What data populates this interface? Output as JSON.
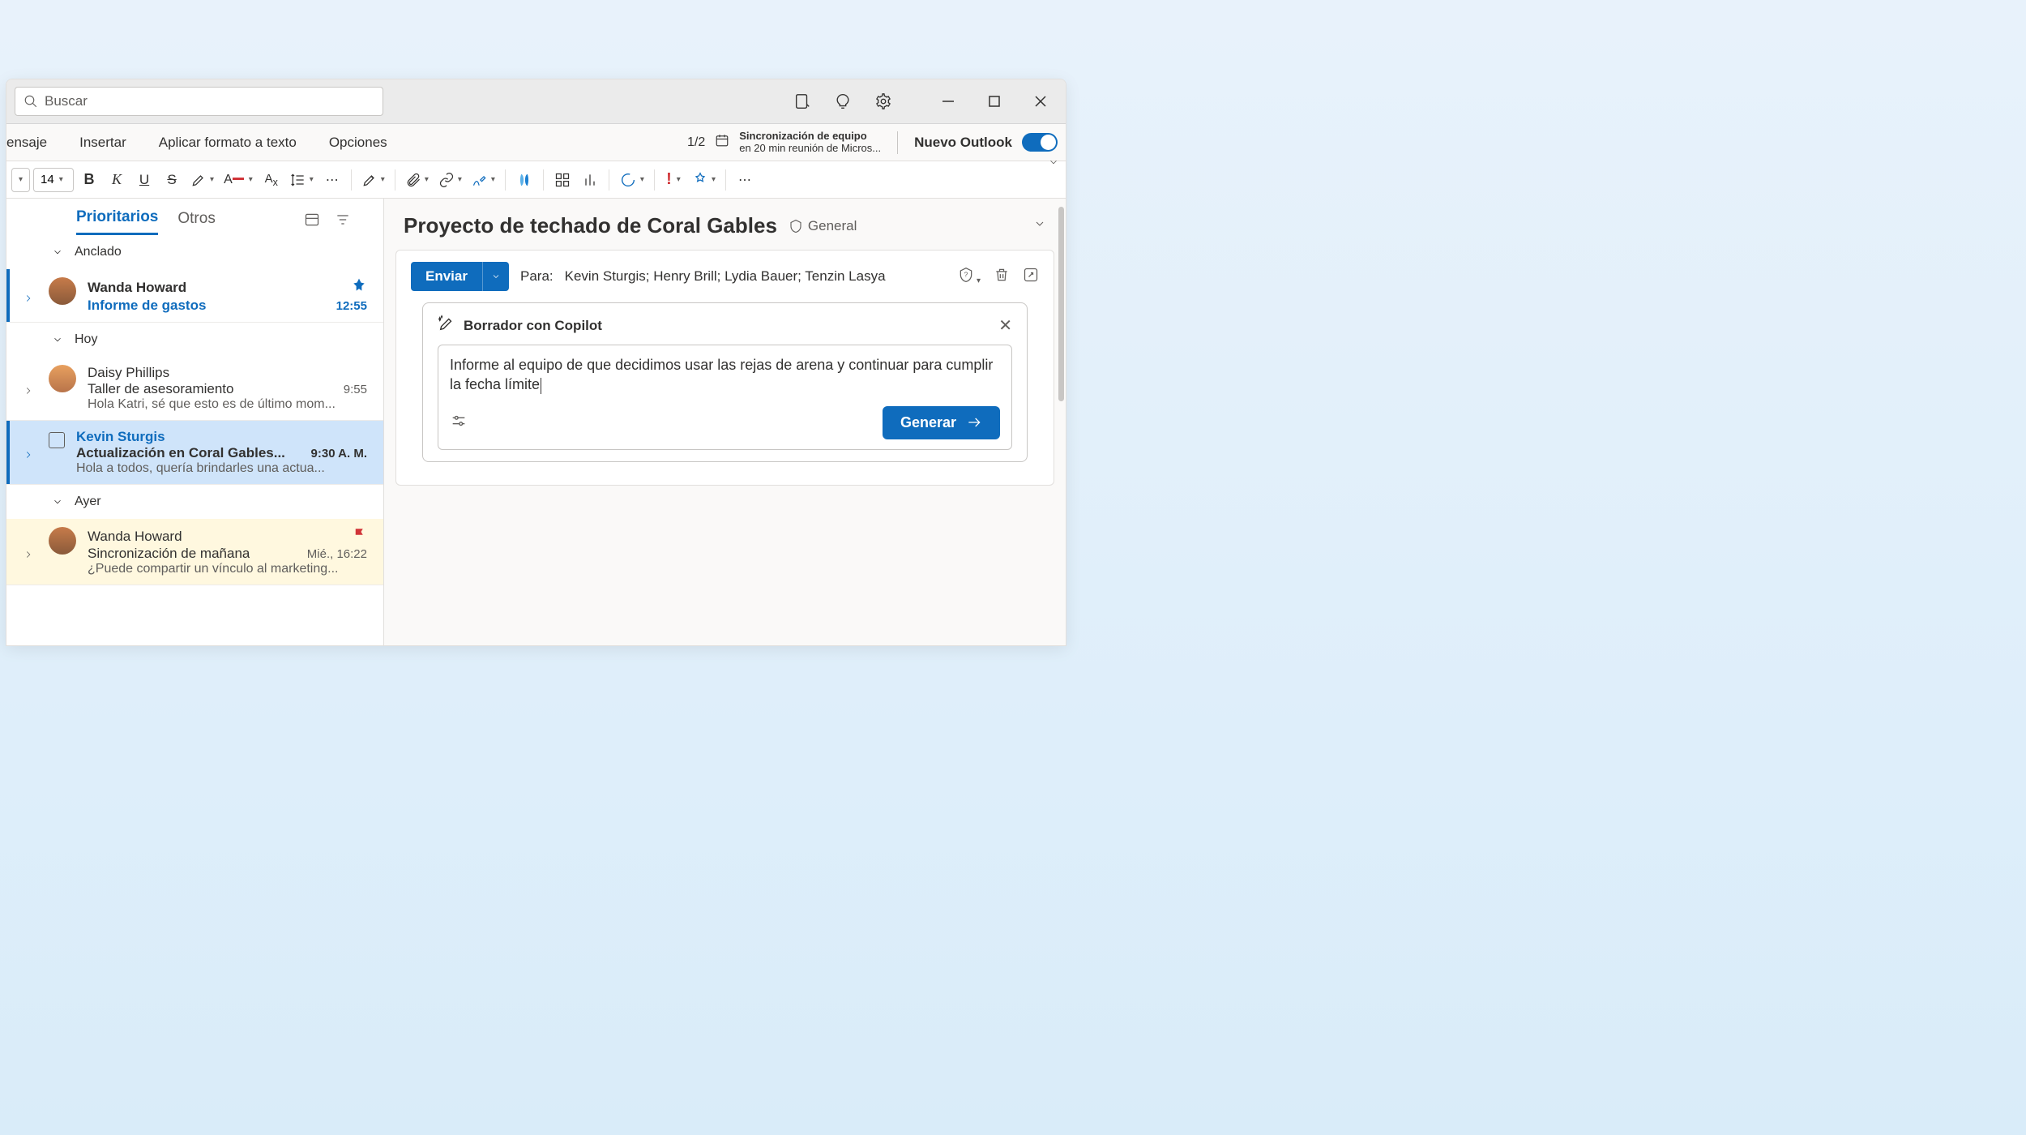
{
  "search": {
    "placeholder": "Buscar"
  },
  "tabs": {
    "message": "ensaje",
    "insert": "Insertar",
    "format": "Aplicar formato a texto",
    "options": "Opciones",
    "count": "1/2"
  },
  "calendar_alert": {
    "title": "Sincronización de equipo",
    "sub": "en 20 min reunión de Micros..."
  },
  "new_outlook": "Nuevo Outlook",
  "toolbar": {
    "fontsize": "14"
  },
  "list": {
    "tab_priority": "Prioritarios",
    "tab_other": "Otros",
    "group_pinned": "Anclado",
    "group_today": "Hoy",
    "group_yesterday": "Ayer",
    "messages": [
      {
        "sender": "Wanda Howard",
        "subject": "Informe de gastos",
        "preview": "",
        "time": "12:55",
        "unread": true
      },
      {
        "sender": "Daisy Phillips",
        "subject": "Taller de asesoramiento",
        "preview": "Hola Katri, sé que esto es de último mom...",
        "time": "9:55"
      },
      {
        "sender": "Kevin Sturgis",
        "subject": "Actualización en Coral Gables...",
        "preview": "Hola a todos, quería brindarles una actua...",
        "time": "9:30 A. M."
      },
      {
        "sender": "Wanda Howard",
        "subject": "Sincronización de mañana",
        "preview": "¿Puede compartir un vínculo al marketing...",
        "time": "Mié., 16:22"
      }
    ]
  },
  "read": {
    "subject": "Proyecto de techado de Coral Gables",
    "label": "General",
    "send": "Enviar",
    "to_label": "Para:",
    "to_list": "Kevin Sturgis; Henry Brill; Lydia Bauer; Tenzin Lasya"
  },
  "copilot": {
    "title": "Borrador con Copilot",
    "draft": "Informe al equipo de que decidimos usar las rejas de arena y continuar para cumplir la fecha límite",
    "generate": "Generar"
  }
}
